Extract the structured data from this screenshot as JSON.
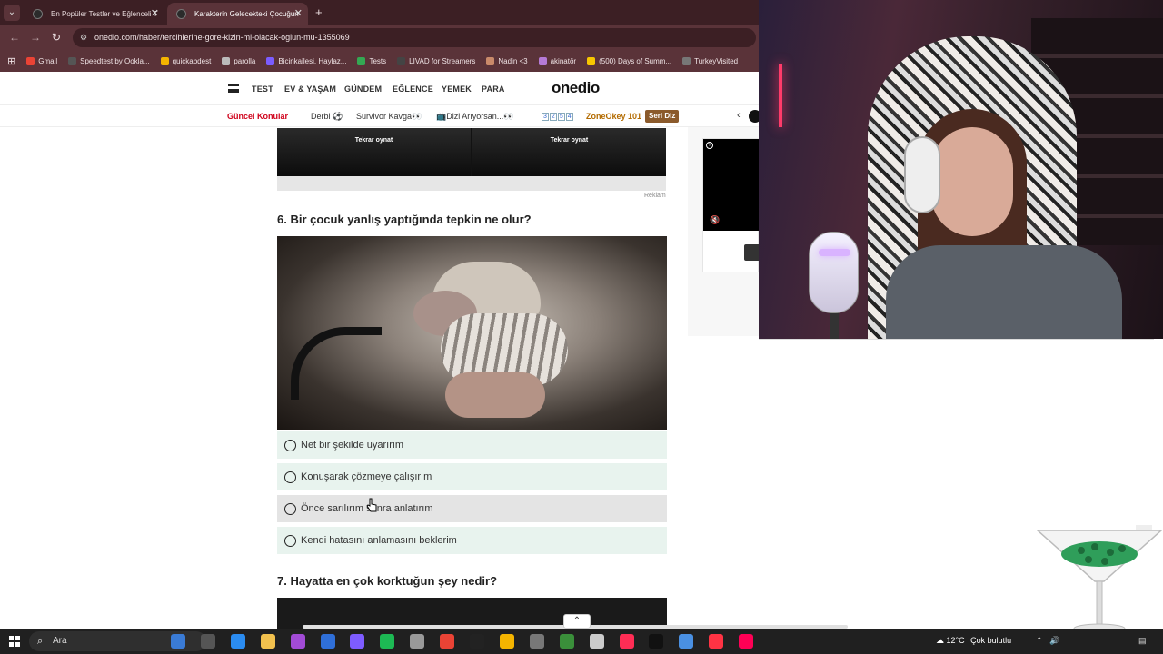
{
  "browser": {
    "tabs": [
      {
        "title": "En Popüler Testler ve Eğlenceli T",
        "active": false
      },
      {
        "title": "Karakterin Gelecekteki Çocuğun",
        "active": true
      }
    ],
    "new_tab_glyph": "+",
    "url": "onedio.com/haber/tercihlerine-gore-kizin-mi-olacak-oglun-mu-1355069",
    "bookmarks": [
      "Gmail",
      "Speedtest by Ookla...",
      "quickabdest",
      "parolla",
      "Bicinkailesi, Haylaz...",
      "Tests",
      "LIVAD for Streamers",
      "Nadin <3",
      "akinatör",
      "(500) Days of Summ...",
      "TurkeyVisited"
    ],
    "bookmark_colors": [
      "#ea4335",
      "#555555",
      "#f4b400",
      "#bbbbbb",
      "#7b5cff",
      "#34a853",
      "#444444",
      "#c98a6a",
      "#b57ad6",
      "#f7c600",
      "#777777"
    ]
  },
  "site": {
    "nav": [
      "TEST",
      "EV & YAŞAM",
      "GÜNDEM",
      "EĞLENCE",
      "YEMEK",
      "PARA"
    ],
    "logo": "onedio",
    "trending": {
      "label": "Güncel Konular",
      "items": [
        "Derbi ⚽",
        "Survivor Kavga👀",
        "📺Dizi Arıyorsan...👀"
      ],
      "numbers": [
        "3",
        "2",
        "5",
        "4"
      ],
      "zone": "ZoneOkey 101",
      "badge": "Seri Diz",
      "prev_glyph": "‹"
    }
  },
  "content": {
    "video_labels": [
      "Tekrar oynat",
      "Tekrar oynat"
    ],
    "ad_label": "Reklam",
    "q6": {
      "title": "6. Bir çocuk yanlış yaptığında tepkin ne olur?",
      "options": [
        "Net bir şekilde uyarırım",
        "Konuşarak çözmeye çalışırım",
        "Önce sarılırım sonra anlatırım",
        "Kendi hatasını anlamasını beklerim"
      ]
    },
    "q7": {
      "title": "7. Hayatta en çok korktuğun şey nedir?"
    },
    "scroll_up_glyph": "⌃",
    "side_ad": {
      "help_glyph": "?",
      "mute_glyph": "🔇"
    }
  },
  "taskbar": {
    "search_placeholder": "Ara",
    "search_glyph": "⌕",
    "app_colors": [
      "#3a7bd5",
      "#555555",
      "#2b8cf0",
      "#f2c14e",
      "#a24bd6",
      "#2f6fd8",
      "#7e5cff",
      "#1db954",
      "#999999",
      "#ea4335",
      "#222222",
      "#f4b400",
      "#777777",
      "#3a8f3a",
      "#cccccc",
      "#ff2d55",
      "#111111",
      "#4a90e2",
      "#ff3344",
      "#ff0055"
    ],
    "weather_temp": "12°C",
    "weather_text": "Çok bulutlu",
    "tray_glyphs": [
      "⌃",
      "🔊"
    ]
  }
}
